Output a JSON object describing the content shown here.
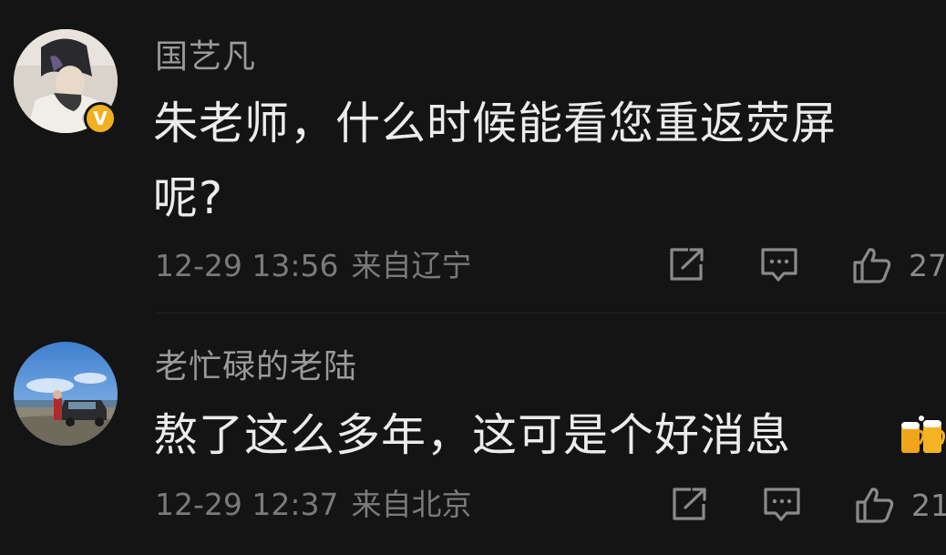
{
  "comments": [
    {
      "username": "国艺凡",
      "verified_badge": "V",
      "content_lines": [
        "朱老师，什么时候能看您重返荧屏",
        "呢?"
      ],
      "timestamp": "12-29 13:56",
      "location": "来自辽宁",
      "like_count": "27"
    },
    {
      "username": "老忙碌的老陆",
      "content_lines": [
        "熬了这么多年，这可是个好消息"
      ],
      "timestamp": "12-29 12:37",
      "location": "来自北京",
      "like_count": "21"
    }
  ],
  "icons": {
    "share": "share-icon",
    "reply": "comment-icon",
    "like": "thumbs-up-icon",
    "emoji": "beer-mugs-emoji"
  },
  "colors": {
    "background": "#141414",
    "username": "#9a9a9a",
    "content": "#ececec",
    "meta": "#7a7a7a",
    "verified_badge": "#f2b01e"
  }
}
